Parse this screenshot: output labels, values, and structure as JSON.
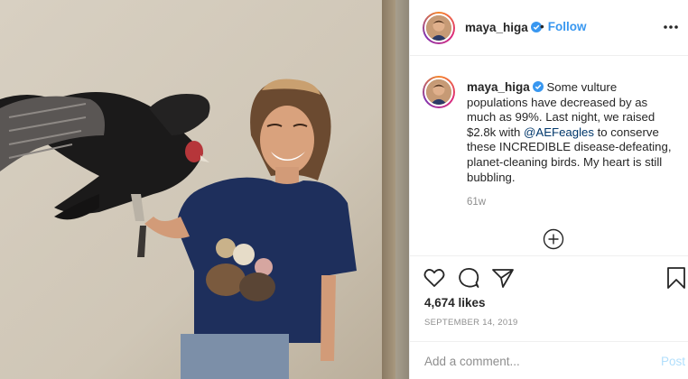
{
  "colors": {
    "accent_blue": "#3897f0",
    "verified_blue": "#3897f0",
    "mention_color": "#00376b",
    "muted_gray": "#8e8e8e",
    "post_disabled": "#b2dffc"
  },
  "post": {
    "photo_alt": "woman in navy t-shirt holding a turkey vulture on her gloved hand",
    "header": {
      "username": "maya_higa",
      "verified_icon": "verified-badge-icon",
      "separator": "•",
      "follow_label": "Follow",
      "more_icon": "more-options-icon"
    },
    "caption": {
      "username": "maya_higa",
      "text_before": " Some vulture populations have decreased by as much as 99%. Last night, we raised $2.8k with ",
      "mention": "@AEFeagles",
      "text_after": " to conserve these INCREDIBLE disease-defeating, planet-cleaning birds. My heart is still bubbling.",
      "time_ago": "61w",
      "load_more_icon": "plus-circle-icon"
    },
    "actions": {
      "like_icon": "heart-icon",
      "comment_icon": "comment-icon",
      "share_icon": "paper-plane-icon",
      "save_icon": "bookmark-icon"
    },
    "likes_label": "4,674 likes",
    "date": "SEPTEMBER 14, 2019",
    "comment_box": {
      "placeholder": "Add a comment...",
      "post_label": "Post"
    }
  }
}
